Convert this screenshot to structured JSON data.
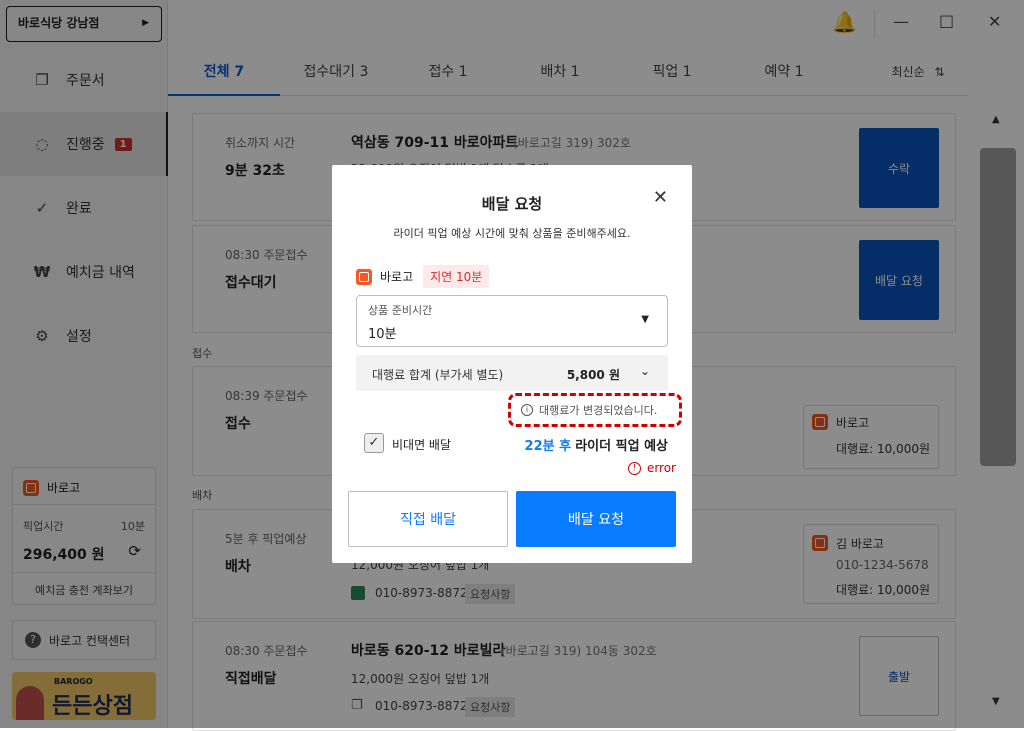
{
  "window": {
    "bell_icon": "bell-icon",
    "minimize": "—",
    "maximize": "□",
    "close": "✕"
  },
  "sidebar": {
    "store_name": "바로식당 강남점",
    "items": [
      {
        "label": "주문서",
        "icon": "document-icon"
      },
      {
        "label": "진행중",
        "icon": "spinner-icon",
        "badge": "1"
      },
      {
        "label": "완료",
        "icon": "check-icon"
      },
      {
        "label": "예치금 내역",
        "icon": "won-icon"
      },
      {
        "label": "설정",
        "icon": "gear-icon"
      }
    ],
    "baro_box": {
      "brand": "바로고",
      "pickup_label": "픽업시간",
      "pickup_value": "10분",
      "balance": "296,400 원",
      "deposit_link": "예치금 충전 계좌보기"
    },
    "help_label": "바로고 컨택센터",
    "banner": {
      "small": "BAROGO",
      "big": "든든상점"
    }
  },
  "tabs": [
    {
      "label": "전체 7"
    },
    {
      "label": "접수대기 3"
    },
    {
      "label": "접수 1"
    },
    {
      "label": "배차 1"
    },
    {
      "label": "픽업 1"
    },
    {
      "label": "예약 1"
    }
  ],
  "sort_label": "최신순",
  "sections": {
    "accept": "접수",
    "dispatch": "배차"
  },
  "cards": {
    "c1": {
      "label": "취소까지 시간",
      "big": "9분 32초",
      "address": "역삼동 709-11 바로아파트",
      "detail": "(바로고길 319)",
      "unit": "302호",
      "line2": "22,000원  오징어 덮밥 1개  닭소금 1개",
      "action": "수락"
    },
    "c2": {
      "label": "08:30 주문접수",
      "big": "접수대기",
      "action": "배달 요청"
    },
    "c3": {
      "label": "08:39 주문접수",
      "big": "접수",
      "rider_brand": "바로고",
      "rider_fee": "대행료: 10,000원"
    },
    "c4": {
      "label": "5분 후 픽업예상",
      "big": "배차",
      "line2": "12,000원  오징어 덮밥 1개",
      "phone": "010-8973-8872",
      "req": "요청사항",
      "rider_name": "김 바로고",
      "rider_phone": "010-1234-5678",
      "rider_fee": "대행료: 10,000원"
    },
    "c5": {
      "label": "08:30 주문접수",
      "big": "직접배달",
      "address": "바로동 620-12 바로빌라",
      "detail": "(바로고길 319)",
      "unit": "104동 302호",
      "line2": "12,000원  오징어 덮밥 1개",
      "phone": "010-8973-8872",
      "req": "요청사항",
      "action": "출발"
    }
  },
  "modal": {
    "title": "배달 요청",
    "subtitle": "라이더 픽업 예상 시간에 맞춰 상품을 준비해주세요.",
    "provider": "바로고",
    "delay_badge": "지연 10분",
    "select_label": "상품 준비시간",
    "select_value": "10분",
    "fee_label": "대행료 합계 (부가세 별도)",
    "fee_value": "5,800 원",
    "notice": "대행료가 변경되었습니다.",
    "contactless_label": "비대면 배달",
    "eta_highlight": "22분 후",
    "eta_text": "라이더 픽업 예상",
    "error_text": "error",
    "btn_direct": "직접 배달",
    "btn_request": "배달 요청",
    "accent": "#0a7cff",
    "error_color": "#d10000"
  }
}
